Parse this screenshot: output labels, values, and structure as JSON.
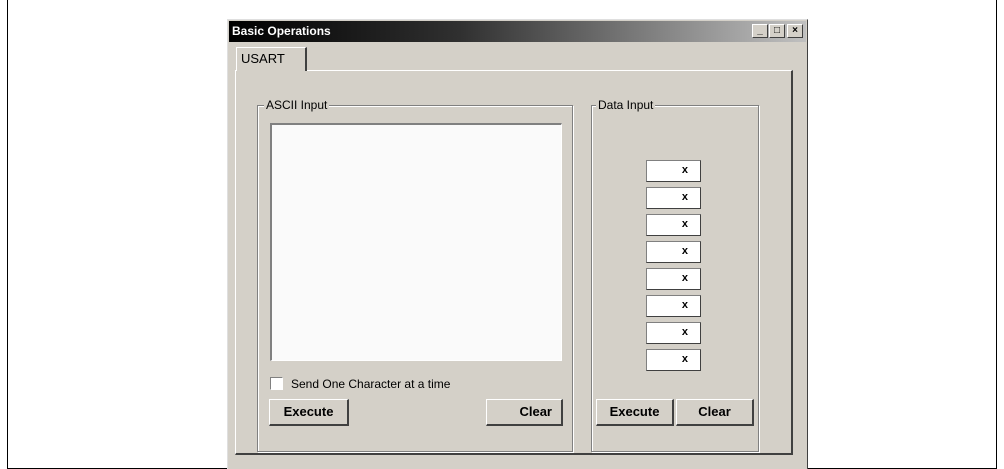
{
  "window": {
    "title": "Basic Operations"
  },
  "titlebar_buttons": {
    "minimize": "_",
    "maximize": "□",
    "close": "×"
  },
  "tabs": [
    {
      "label": "USART"
    }
  ],
  "ascii_group": {
    "label": "ASCII Input",
    "text": "",
    "checkbox_label": "Send One Character at a time",
    "checkbox_checked": false,
    "execute_label": "Execute",
    "clear_label": "Clear"
  },
  "data_group": {
    "label": "Data Input",
    "cells": [
      "x",
      "x",
      "x",
      "x",
      "x",
      "x",
      "x",
      "x"
    ],
    "execute_label": "Execute",
    "clear_label": "Clear"
  }
}
